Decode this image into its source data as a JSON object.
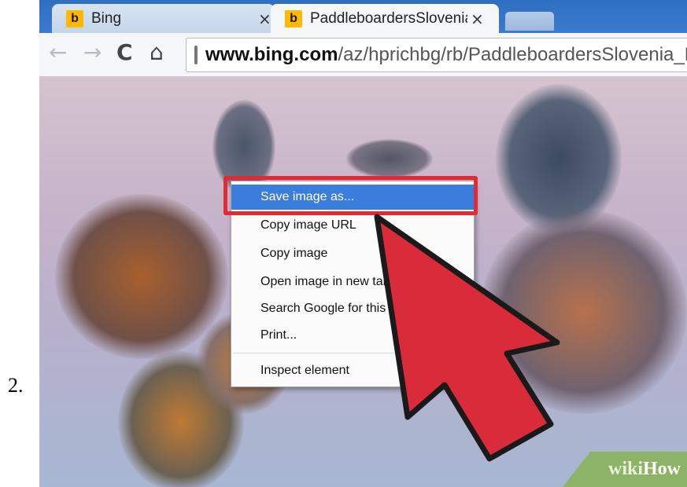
{
  "step_number": "2.",
  "browser": {
    "tabs": [
      {
        "title": "Bing",
        "close": "×",
        "favicon": "bing-icon"
      },
      {
        "title": "PaddleboardersSlovenia_R",
        "close": "×",
        "favicon": "bing-icon"
      }
    ],
    "toolbar": {
      "back_icon": "←",
      "forward_icon": "→",
      "reload_icon": "C",
      "home_icon": "⌂",
      "url_domain": "www.bing.com",
      "url_path": "/az/hprichbg/rb/PaddleboardersSlovenia_RO"
    }
  },
  "context_menu": {
    "items": [
      {
        "label": "Save image as...",
        "highlighted": true
      },
      {
        "label": "Copy image URL"
      },
      {
        "label": "Copy image"
      },
      {
        "label": "Open image in new tab"
      },
      {
        "label": "Search Google for this image"
      },
      {
        "label": "Print..."
      },
      {
        "label": "Inspect element"
      }
    ]
  },
  "watermark": {
    "wiki": "wiki",
    "how": "How"
  },
  "colors": {
    "highlight_box": "#e02a36",
    "menu_highlight": "#3b7ddd",
    "arrow": "#d92b3a"
  }
}
